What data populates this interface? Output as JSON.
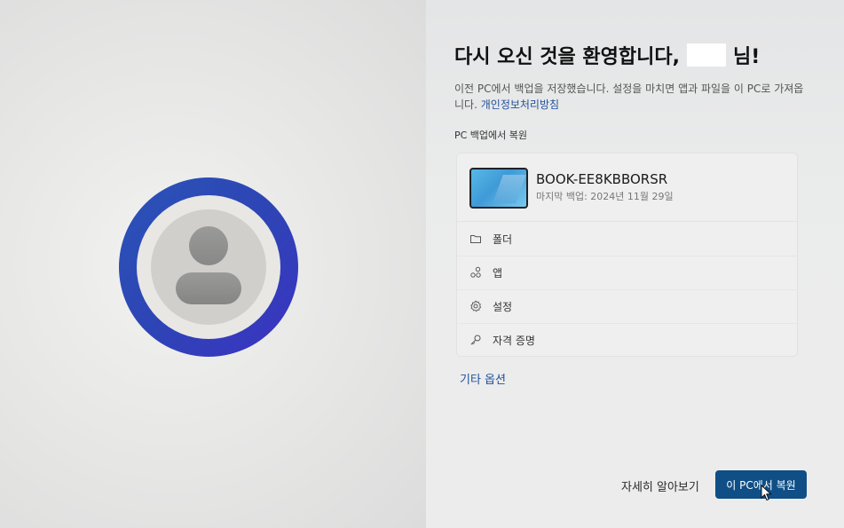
{
  "page": {
    "title_prefix": "다시 오신 것을 환영합니다,",
    "title_suffix": "님!",
    "subtitle": "이전 PC에서 백업을 저장했습니다. 설정을 마치면 앱과 파일을 이 PC로 가져옵니다.",
    "privacy_link": "개인정보처리방침",
    "section_label": "PC 백업에서 복원"
  },
  "backup": {
    "device_name": "BOOK-EE8KBBORSR",
    "last_backup": "마지막 백업: 2024년 11월 29일",
    "items": [
      {
        "label": "폴더",
        "icon": "folder-icon"
      },
      {
        "label": "앱",
        "icon": "apps-icon"
      },
      {
        "label": "설정",
        "icon": "gear-icon"
      },
      {
        "label": "자격 증명",
        "icon": "key-icon"
      }
    ]
  },
  "actions": {
    "other_options": "기타 옵션",
    "learn_more": "자세히 알아보기",
    "restore": "이 PC에서 복원"
  },
  "colors": {
    "accent": "#0f4f86",
    "link": "#1f4f9a",
    "avatar_ring": "#2e45b5"
  }
}
